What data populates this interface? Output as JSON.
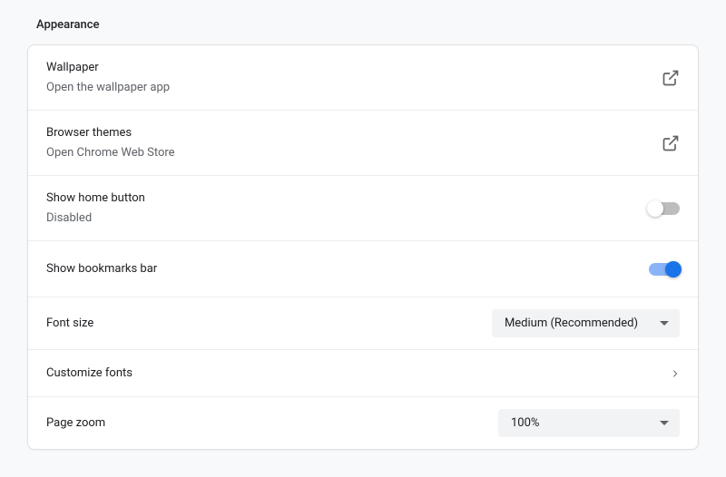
{
  "section_title": "Appearance",
  "rows": {
    "wallpaper": {
      "title": "Wallpaper",
      "subtitle": "Open the wallpaper app"
    },
    "themes": {
      "title": "Browser themes",
      "subtitle": "Open Chrome Web Store"
    },
    "home_button": {
      "title": "Show home button",
      "subtitle": "Disabled",
      "enabled": false
    },
    "bookmarks_bar": {
      "title": "Show bookmarks bar",
      "enabled": true
    },
    "font_size": {
      "title": "Font size",
      "value": "Medium (Recommended)"
    },
    "customize_fonts": {
      "title": "Customize fonts"
    },
    "page_zoom": {
      "title": "Page zoom",
      "value": "100%"
    }
  }
}
